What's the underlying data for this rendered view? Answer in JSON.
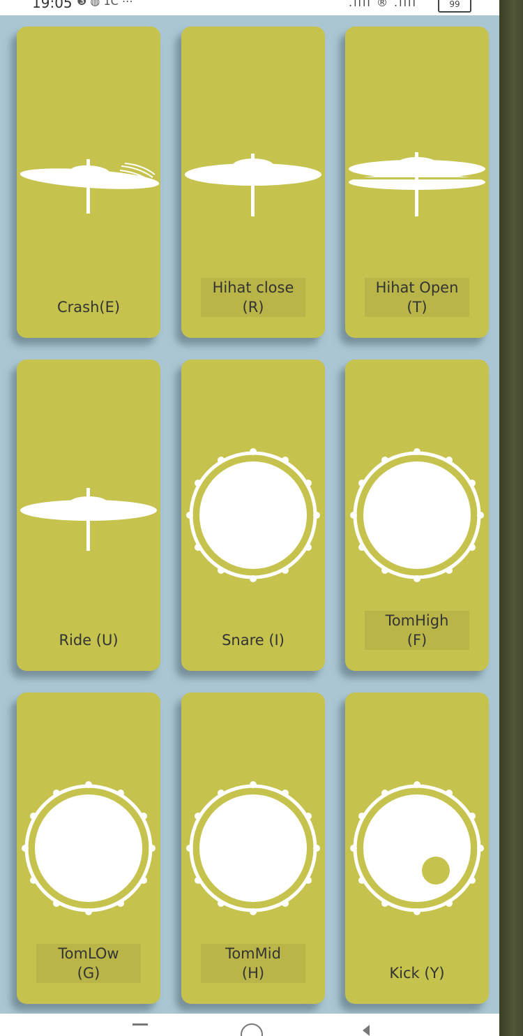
{
  "status_bar": {
    "time": "19:05",
    "left_icons": "❸ ◍ 1C ⋯",
    "right_icons": ".ııll ® .ııll",
    "battery": "99"
  },
  "pads": [
    {
      "label": "Crash(E)",
      "icon": "crash-cymbal-icon"
    },
    {
      "label": "Hihat close (R)",
      "icon": "hihat-closed-icon"
    },
    {
      "label": "Hihat Open (T)",
      "icon": "hihat-open-icon"
    },
    {
      "label": "Ride (U)",
      "icon": "ride-cymbal-icon"
    },
    {
      "label": "Snare (I)",
      "icon": "snare-drum-icon"
    },
    {
      "label": "TomHigh (F)",
      "icon": "tom-high-drum-icon"
    },
    {
      "label": "TomLOw (G)",
      "icon": "tom-low-drum-icon"
    },
    {
      "label": "TomMid (H)",
      "icon": "tom-mid-drum-icon"
    },
    {
      "label": "Kick (Y)",
      "icon": "kick-drum-icon"
    }
  ],
  "colors": {
    "pad": "#c5c24d",
    "background": "#a9c6d2",
    "icon": "#ffffff"
  }
}
